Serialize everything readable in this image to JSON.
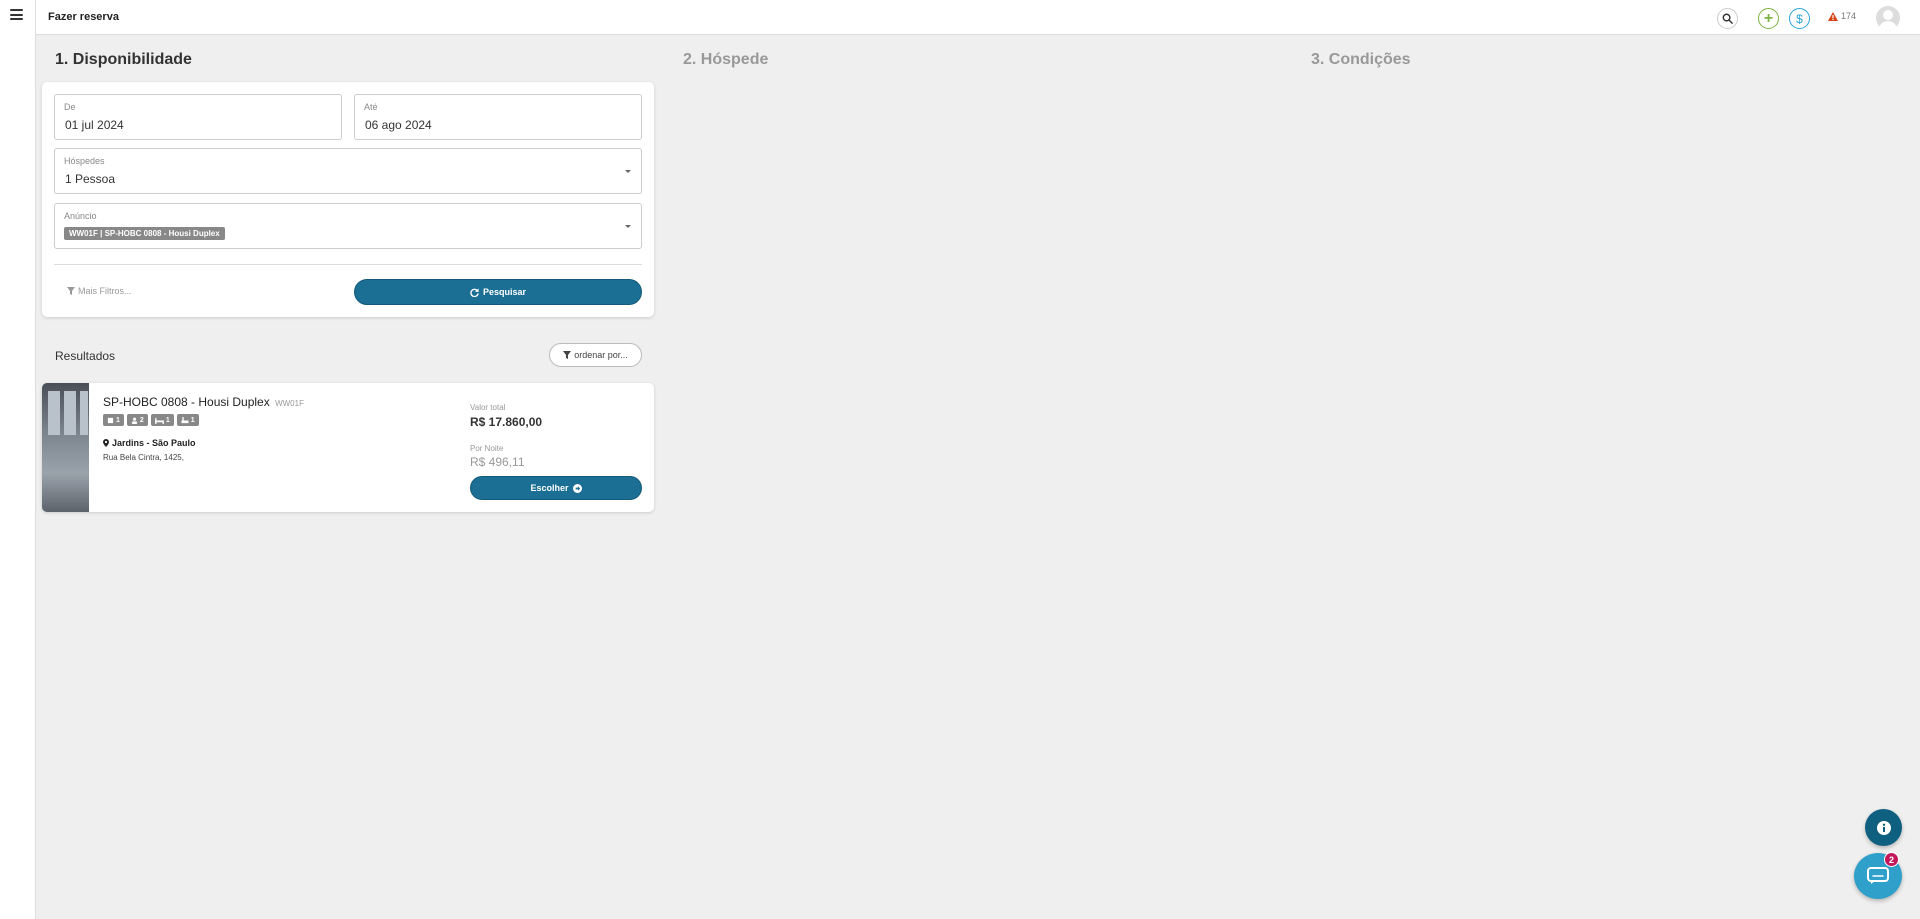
{
  "header": {
    "title": "Fazer reserva",
    "alert_count": "174"
  },
  "steps": [
    {
      "label": "1. Disponibilidade",
      "active": true
    },
    {
      "label": "2. Hóspede",
      "active": false
    },
    {
      "label": "3. Condições",
      "active": false
    }
  ],
  "form": {
    "from_label": "De",
    "from_value": "01 jul 2024",
    "to_label": "Até",
    "to_value": "06 ago 2024",
    "guests_label": "Hóspedes",
    "guests_value": "1 Pessoa",
    "listing_label": "Anúncio",
    "listing_chip": "WW01F | SP-HOBC 0808 - Housi Duplex",
    "more_filters": "Mais Filtros...",
    "search_button": "Pesquisar"
  },
  "results": {
    "title": "Resultados",
    "sort_button": "ordenar por...",
    "items": [
      {
        "name": "SP-HOBC 0808 - Housi Duplex",
        "code": "WW01F",
        "badges": [
          "1",
          "2",
          "1",
          "1"
        ],
        "location": "Jardins - São Paulo",
        "address": "Rua Bela Cintra, 1425,",
        "total_label": "Valor total",
        "total_value": "R$ 17.860,00",
        "night_label": "Por Noite",
        "night_value": "R$ 496,11",
        "choose_button": "Escolher"
      }
    ]
  },
  "chat": {
    "unread": "2"
  },
  "colors": {
    "primary": "#1b6f94",
    "plus": "#7cb342",
    "dollar": "#29a3d6",
    "alert": "#d84315",
    "chat": "#2fa0c9",
    "badge": "#c2185b"
  }
}
